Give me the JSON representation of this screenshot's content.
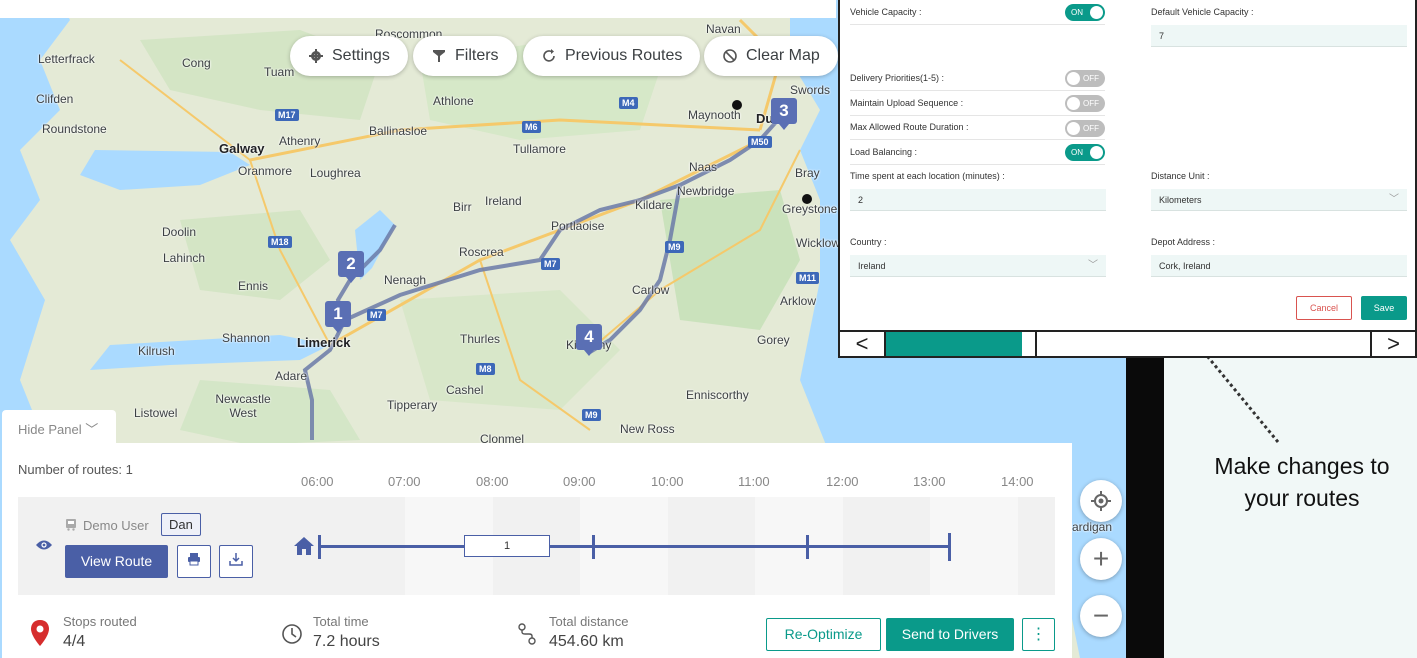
{
  "toolbar": {
    "settings_label": "Settings",
    "filters_label": "Filters",
    "previous_routes_label": "Previous Routes",
    "clear_map_label": "Clear Map"
  },
  "map": {
    "places": [
      "Roscommon",
      "Navan",
      "Letterfrack",
      "Cong",
      "Tuam",
      "Clifden",
      "Athlone",
      "Swords",
      "Roundstone",
      "Ballinasloe",
      "Maynooth",
      "Galway",
      "Athenry",
      "Tullamore",
      "Oranmore",
      "Loughrea",
      "Naas",
      "Bray",
      "Newbridge",
      "Birr",
      "Ireland",
      "Kildare",
      "Greystone",
      "Doolin",
      "Portlaoise",
      "Wicklow",
      "Lahinch",
      "Roscrea",
      "Nenagh",
      "Ennis",
      "Carlow",
      "Arklow",
      "Shannon",
      "Limerick",
      "Thurles",
      "Gorey",
      "Kilrush",
      "Kilkenny",
      "Adare",
      "Cashel",
      "Enniscorthy",
      "Newcastle West",
      "Listowel",
      "Tipperary",
      "New Ross",
      "Clonmel",
      "Dublin",
      "ardigan"
    ],
    "road_shields": [
      "M17",
      "M4",
      "M6",
      "M50",
      "M18",
      "M7",
      "M7",
      "M9",
      "M8",
      "M11",
      "M9"
    ],
    "markers": [
      "1",
      "2",
      "3",
      "4"
    ]
  },
  "settings": {
    "vehicle_capacity_label": "Vehicle Capacity :",
    "vehicle_capacity_toggle": "ON",
    "default_vehicle_capacity_label": "Default Vehicle Capacity :",
    "default_vehicle_capacity_value": "7",
    "delivery_priorities_label": "Delivery Priorities(1-5) :",
    "delivery_priorities_toggle": "OFF",
    "maintain_upload_label": "Maintain Upload Sequence :",
    "maintain_upload_toggle": "OFF",
    "max_route_duration_label": "Max Allowed Route Duration :",
    "max_route_duration_toggle": "OFF",
    "load_balancing_label": "Load Balancing :",
    "load_balancing_toggle": "ON",
    "time_spent_label": "Time spent at each location (minutes) :",
    "time_spent_value": "2",
    "distance_unit_label": "Distance Unit :",
    "distance_unit_value": "Kilometers",
    "country_label": "Country :",
    "country_value": "Ireland",
    "depot_address_label": "Depot Address :",
    "depot_address_value": "Cork, Ireland",
    "cancel_label": "Cancel",
    "save_label": "Save",
    "prev_symbol": "<",
    "next_symbol": ">",
    "progress": 0.28
  },
  "tutorial": {
    "line1": "Make changes to",
    "line2": "your routes"
  },
  "panel": {
    "hide_panel_label": "Hide Panel",
    "routes_count_label": "Number of routes:",
    "routes_count_value": "1",
    "timeline_hours": [
      "06:00",
      "07:00",
      "08:00",
      "09:00",
      "10:00",
      "11:00",
      "12:00",
      "13:00",
      "14:00"
    ],
    "route": {
      "user": "Demo User",
      "driver": "Dan",
      "view_route_label": "View Route",
      "segment_label": "1"
    },
    "stats": {
      "stops_label": "Stops routed",
      "stops_value": "4/4",
      "time_label": "Total time",
      "time_value": "7.2 hours",
      "distance_label": "Total distance",
      "distance_value": "454.60 km"
    },
    "reoptimize_label": "Re-Optimize",
    "send_label": "Send to Drivers",
    "more_symbol": "⋮"
  },
  "colors": {
    "accent_teal": "#0a9a8a",
    "route_blue": "#4a5fa6",
    "map_land": "#e4ead6",
    "map_sea": "#aadaff"
  }
}
